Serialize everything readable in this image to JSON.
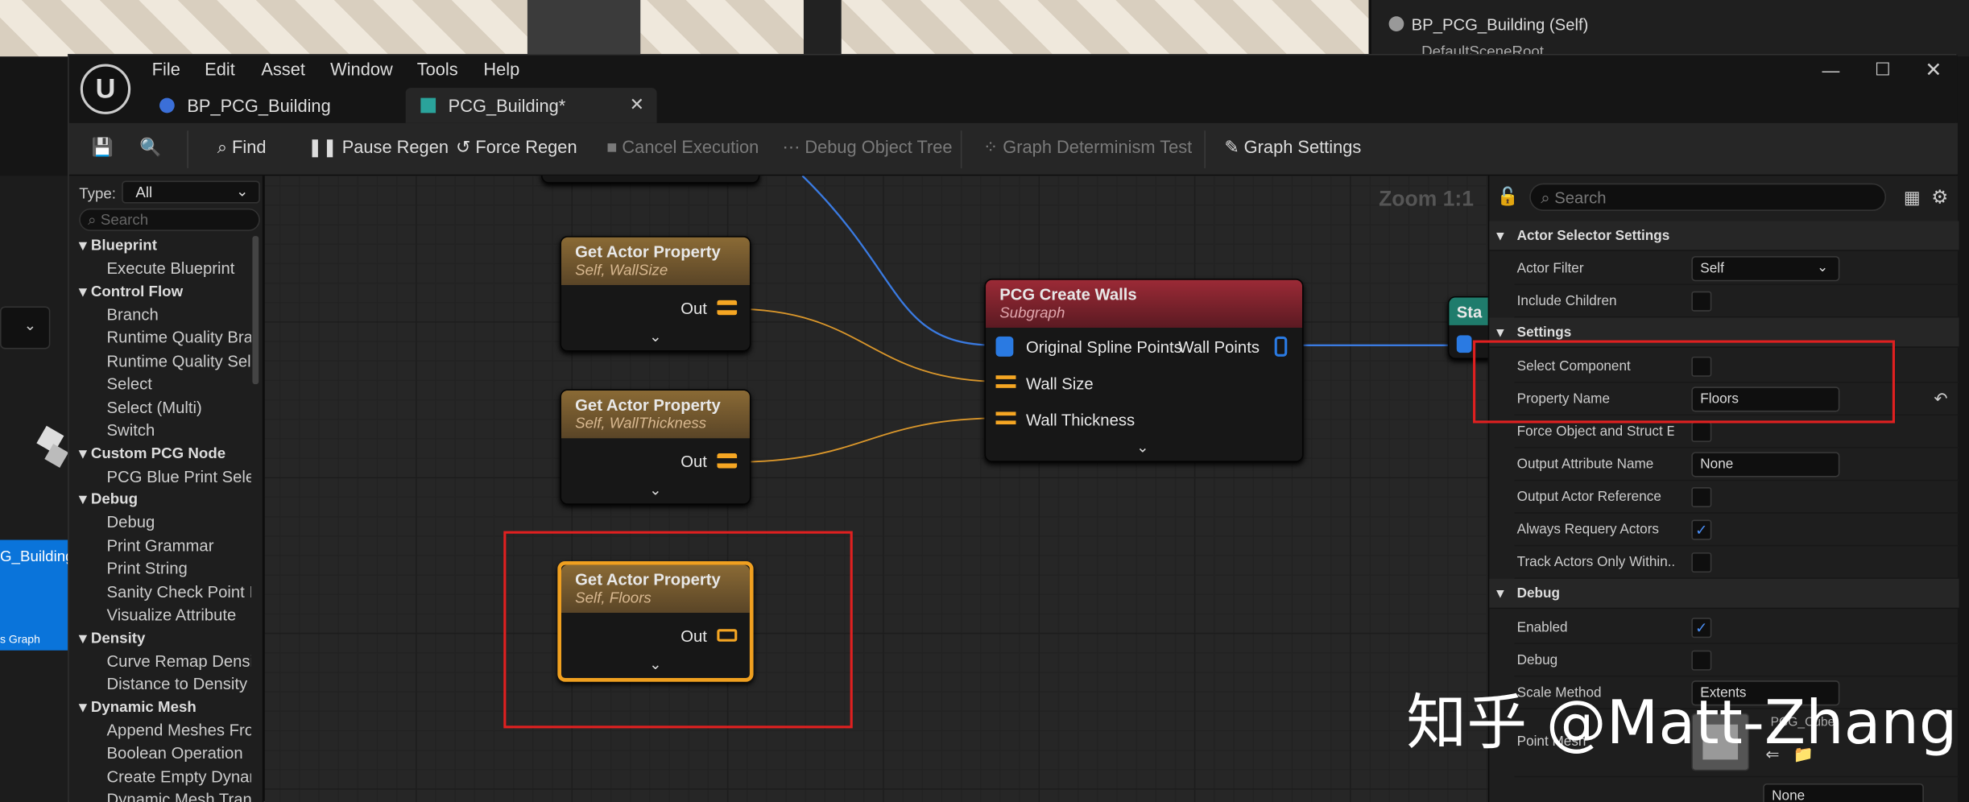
{
  "outliner": {
    "item": "BP_PCG_Building (Self)",
    "subitem": "DefaultSceneRoot"
  },
  "menu": [
    "File",
    "Edit",
    "Asset",
    "Window",
    "Tools",
    "Help"
  ],
  "tabs": [
    {
      "label": "BP_PCG_Building"
    },
    {
      "label": "PCG_Building*"
    }
  ],
  "toolbar": {
    "find": "Find",
    "pause": "Pause Regen",
    "force": "Force Regen",
    "cancel": "Cancel Execution",
    "debug_tree": "Debug Object Tree",
    "determinism": "Graph Determinism Test",
    "settings": "Graph Settings"
  },
  "palette": {
    "type_label": "Type:",
    "type_value": "All",
    "search_placeholder": "Search",
    "categories": [
      {
        "name": "Blueprint",
        "items": [
          "Execute Blueprint"
        ]
      },
      {
        "name": "Control Flow",
        "items": [
          "Branch",
          "Runtime Quality Bra",
          "Runtime Quality Sel",
          "Select",
          "Select (Multi)",
          "Switch"
        ]
      },
      {
        "name": "Custom PCG Node",
        "items": [
          "PCG Blue Print Sele"
        ]
      },
      {
        "name": "Debug",
        "items": [
          "Debug",
          "Print Grammar",
          "Print String",
          "Sanity Check Point I",
          "Visualize Attribute"
        ]
      },
      {
        "name": "Density",
        "items": [
          "Curve Remap Densi",
          "Distance to Density"
        ]
      },
      {
        "name": "Dynamic Mesh",
        "items": [
          "Append Meshes Fro",
          "Boolean Operation",
          "Create Empty Dynar",
          "Dynamic Mesh Tran"
        ]
      }
    ]
  },
  "left_strip": {
    "selected": "G_Building",
    "sub": "s Graph"
  },
  "graph": {
    "zoom": "Zoom 1:1",
    "nodes": [
      {
        "title": "Get Actor Property",
        "subtitle": "Self, WallSize",
        "out": "Out"
      },
      {
        "title": "Get Actor Property",
        "subtitle": "Self, WallThickness",
        "out": "Out"
      },
      {
        "title": "Get Actor Property",
        "subtitle": "Self, Floors",
        "out": "Out"
      }
    ],
    "walls": {
      "title": "PCG Create Walls",
      "subtitle": "Subgraph",
      "in1": "Original Spline Points",
      "in2": "Wall Size",
      "in3": "Wall Thickness",
      "out": "Wall Points"
    },
    "partial_node": "Sta"
  },
  "details": {
    "search_placeholder": "Search",
    "sections": {
      "actor_selector": "Actor Selector Settings",
      "settings": "Settings",
      "debug": "Debug"
    },
    "rows": {
      "actor_filter": {
        "label": "Actor Filter",
        "value": "Self"
      },
      "include_children": {
        "label": "Include Children"
      },
      "select_component": {
        "label": "Select Component"
      },
      "property_name": {
        "label": "Property Name",
        "value": "Floors"
      },
      "force_object": {
        "label": "Force Object and Struct E..."
      },
      "output_attr": {
        "label": "Output Attribute Name",
        "value": "None"
      },
      "output_actor": {
        "label": "Output Actor Reference"
      },
      "always_requery": {
        "label": "Always Requery Actors"
      },
      "track_actors": {
        "label": "Track Actors Only Within..."
      },
      "enabled": {
        "label": "Enabled"
      },
      "debug": {
        "label": "Debug"
      },
      "scale_method": {
        "label": "Scale Method",
        "value": "Extents"
      },
      "point_mesh": {
        "label": "Point Mesh",
        "value": "PCG_Cube"
      },
      "material": {
        "value": "None"
      }
    }
  },
  "watermark": "知乎 @Matt-Zhang",
  "colors": {
    "accent": "#2a7ae2",
    "highlight": "#e02020",
    "float_pin": "#f5a623",
    "point_pin": "#2a7ae2"
  }
}
